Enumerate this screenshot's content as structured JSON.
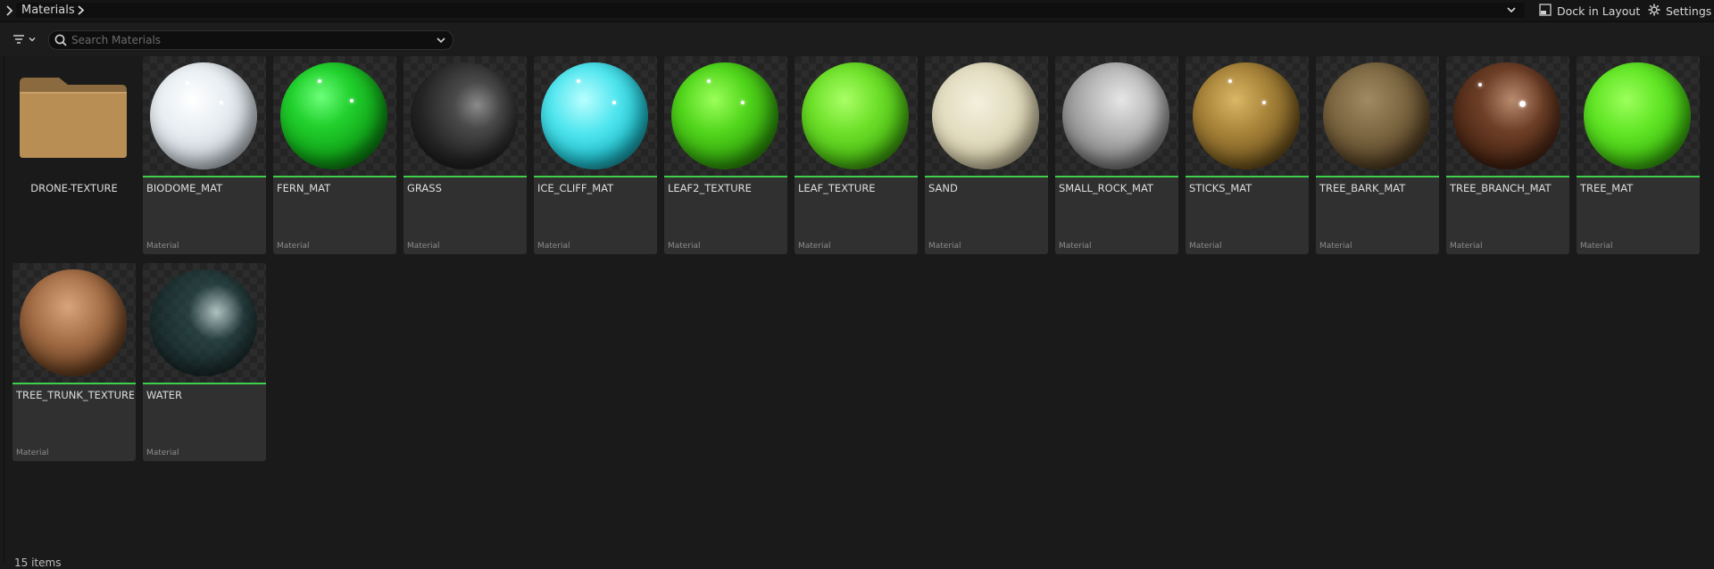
{
  "topbar": {
    "path_label": "Materials",
    "dock_label": "Dock in Layout",
    "settings_label": "Settings"
  },
  "filterbar": {
    "search_placeholder": "Search Materials"
  },
  "folder": {
    "name": "DRONE-TEXTURE",
    "icon": "folder-icon"
  },
  "assets": [
    {
      "name": "BIODOME_MAT",
      "type": "Material"
    },
    {
      "name": "FERN_MAT",
      "type": "Material"
    },
    {
      "name": "GRASS",
      "type": "Material"
    },
    {
      "name": "ICE_CLIFF_MAT",
      "type": "Material"
    },
    {
      "name": "LEAF2_TEXTURE",
      "type": "Material"
    },
    {
      "name": "LEAF_TEXTURE",
      "type": "Material"
    },
    {
      "name": "SAND",
      "type": "Material"
    },
    {
      "name": "SMALL_ROCK_MAT",
      "type": "Material"
    },
    {
      "name": "STICKS_MAT",
      "type": "Material"
    },
    {
      "name": "TREE_BARK_MAT",
      "type": "Material"
    },
    {
      "name": "TREE_BRANCH_MAT",
      "type": "Material"
    },
    {
      "name": "TREE_MAT",
      "type": "Material"
    },
    {
      "name": "TREE_TRUNK_TEXTURES",
      "type": "Material"
    },
    {
      "name": "WATER",
      "type": "Material"
    }
  ],
  "status": {
    "item_count": "15 items"
  },
  "colors": {
    "asset_bar": "#3dd04a",
    "background": "#1a1a1a",
    "tile": "#303030"
  }
}
